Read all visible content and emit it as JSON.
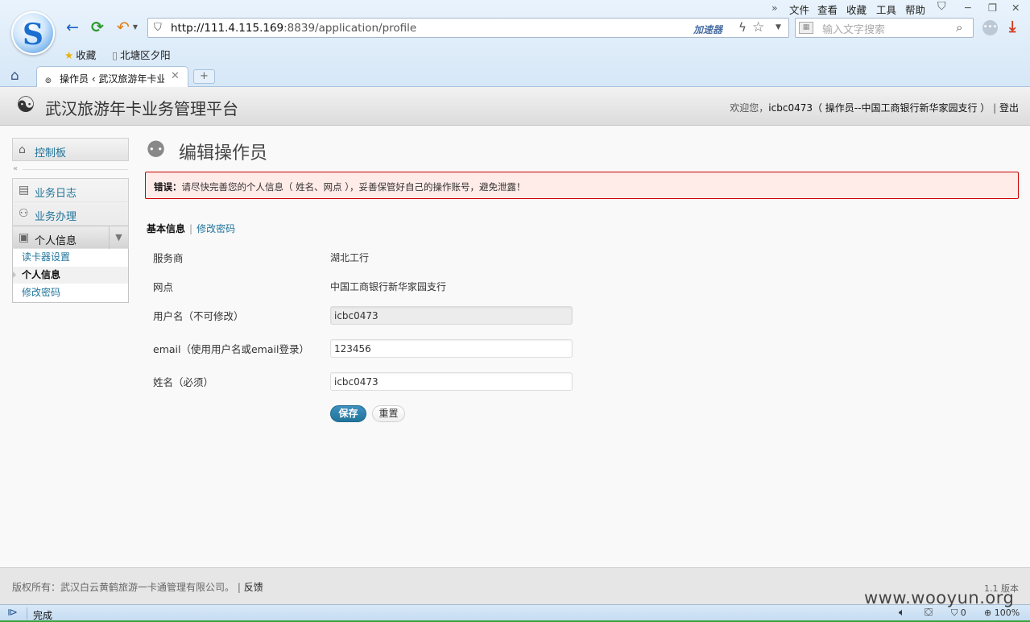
{
  "browser": {
    "url_host": "http://111.4.115.169",
    "url_rest": ":8839/application/profile",
    "accelerator": "加速器",
    "search_placeholder": "输入文字搜索",
    "menu": {
      "file": "文件",
      "view": "查看",
      "favorites": "收藏",
      "tools": "工具",
      "help": "帮助"
    },
    "bookmarks": [
      "收藏",
      "北塘区夕阳"
    ],
    "tab_title": "操作员 ‹ 武汉旅游年卡业",
    "status_text": "完成",
    "status_ad_count": "0",
    "zoom": "100%"
  },
  "header": {
    "site_title": "武汉旅游年卡业务管理平台",
    "welcome": "欢迎您，",
    "username": "icbc0473",
    "role_info": "（ 操作员--中国工商银行新华家园支行 ）",
    "separator": "|",
    "logout": "登出"
  },
  "sidebar": {
    "dashboard": "控制板",
    "business_log": "业务日志",
    "business_handle": "业务办理",
    "personal_info": "个人信息",
    "submenu": [
      "读卡器设置",
      "个人信息",
      "修改密码"
    ]
  },
  "main": {
    "title": "编辑操作员",
    "error_label": "错误：",
    "error_message": "请尽快完善您的个人信息（ 姓名、网点 ），妥善保管好自己的操作账号，避免泄露！",
    "subnav_current": "基本信息",
    "subnav_sep": "|",
    "subnav_link": "修改密码",
    "fields": {
      "service_provider_label": "服务商",
      "service_provider_value": "湖北工行",
      "branch_label": "网点",
      "branch_value": "中国工商银行新华家园支行",
      "username_label": "用户名（不可修改）",
      "username_value": "icbc0473",
      "email_label": "email（使用用户名或email登录）",
      "email_value": "123456",
      "name_label": "姓名（必须）",
      "name_value": "icbc0473"
    },
    "save_button": "保存",
    "reset_button": "重置"
  },
  "footer": {
    "copyright": "版权所有：武汉白云黄鹤旅游一卡通管理有限公司。 |",
    "feedback": "反馈",
    "version": "1.1 版本"
  },
  "watermark": "www.wooyun.org"
}
